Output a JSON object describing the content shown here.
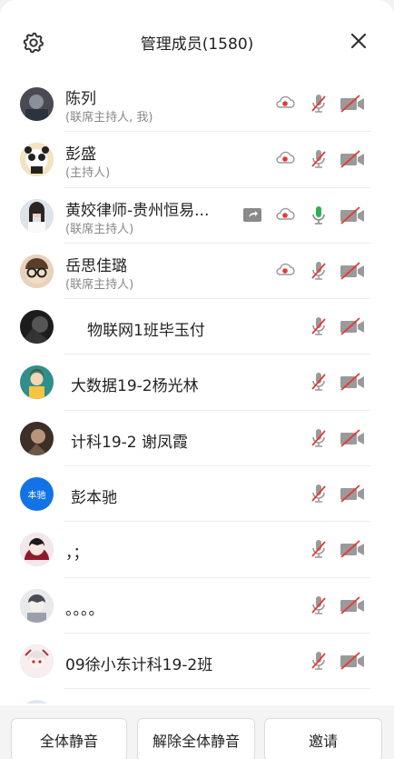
{
  "header": {
    "title": "管理成员(1580)"
  },
  "members": [
    {
      "name": "陈列",
      "role": "(联席主持人, 我)",
      "avatar": "photo-dark",
      "recording": true,
      "sharing": false,
      "mic_on": false
    },
    {
      "name": "彭盛",
      "role": "(主持人)",
      "avatar": "panda",
      "recording": true,
      "sharing": false,
      "mic_on": false
    },
    {
      "name": "黄姣律师-贵州恒易...",
      "role": "(联席主持人)",
      "avatar": "woman",
      "recording": true,
      "sharing": true,
      "mic_on": true
    },
    {
      "name": "岳思佳璐",
      "role": "(联席主持人)",
      "avatar": "glasses",
      "recording": true,
      "sharing": false,
      "mic_on": false
    },
    {
      "name": "物联网1班毕玉付",
      "role": "",
      "avatar": "dark",
      "recording": false,
      "sharing": false,
      "mic_on": false
    },
    {
      "name": "大数据19-2杨光林",
      "role": "",
      "avatar": "teal",
      "recording": false,
      "sharing": false,
      "mic_on": false
    },
    {
      "name": "计科19-2 谢凤霞",
      "role": "",
      "avatar": "brown",
      "recording": false,
      "sharing": false,
      "mic_on": false
    },
    {
      "name": "彭本驰",
      "role": "",
      "avatar": "本驰",
      "recording": false,
      "sharing": false,
      "mic_on": false
    },
    {
      "name": "，；",
      "role": "",
      "avatar": "red-anime",
      "recording": false,
      "sharing": false,
      "mic_on": false
    },
    {
      "name": "。。。。",
      "role": "",
      "avatar": "grey-anime",
      "recording": false,
      "sharing": false,
      "mic_on": false
    },
    {
      "name": "09徐小东计科19-2班",
      "role": "",
      "avatar": "pink-anime",
      "recording": false,
      "sharing": false,
      "mic_on": false
    }
  ],
  "footer": {
    "mute_all": "全体静音",
    "unmute_all": "解除全体静音",
    "invite": "邀请"
  },
  "colors": {
    "accent": "#1273e6",
    "red": "#e53935",
    "mic_green": "#2bb24c",
    "icon_grey": "#9a9a9a"
  }
}
